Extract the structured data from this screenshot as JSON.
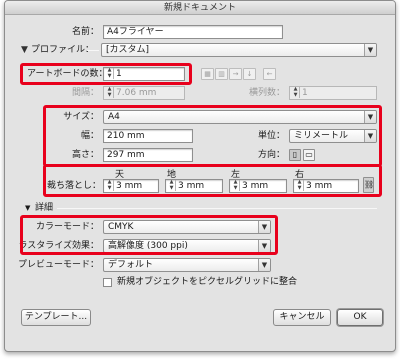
{
  "window": {
    "title": "新規ドキュメント"
  },
  "name": {
    "label": "名前：",
    "value": "A4フライヤー"
  },
  "profile": {
    "section_label": "プロファイル：",
    "value": "[カスタム]"
  },
  "artboards": {
    "count_label": "アートボードの数：",
    "count_value": "1",
    "spacing_label": "間隔：",
    "spacing_value": "7.06 mm",
    "columns_label": "横列数：",
    "columns_value": "1",
    "arrange_icons": [
      "grid-by-row-icon",
      "grid-by-column-icon",
      "arrange-by-row-icon",
      "arrange-by-column-icon",
      "change-to-right-to-left-icon"
    ]
  },
  "size": {
    "label": "サイズ：",
    "value": "A4"
  },
  "width": {
    "label": "幅：",
    "value": "210 mm"
  },
  "units": {
    "label": "単位：",
    "value": "ミリメートル"
  },
  "height": {
    "label": "高さ：",
    "value": "297 mm"
  },
  "orientation": {
    "label": "方向：",
    "icons": [
      "portrait-icon",
      "landscape-icon"
    ]
  },
  "bleed": {
    "label": "裁ち落とし：",
    "top_label": "天",
    "top_value": "3 mm",
    "bottom_label": "地",
    "bottom_value": "3 mm",
    "left_label": "左",
    "left_value": "3 mm",
    "right_label": "右",
    "right_value": "3 mm",
    "link_icon": "chain-link-icon"
  },
  "advanced": {
    "section_label": "詳細",
    "color_mode_label": "カラーモード：",
    "color_mode_value": "CMYK",
    "raster_label": "ラスタライズ効果：",
    "raster_value": "高解像度 (300 ppi)",
    "preview_label": "プレビューモード：",
    "preview_value": "デフォルト",
    "align_pixel_label": "新規オブジェクトをピクセルグリッドに整合"
  },
  "buttons": {
    "templates": "テンプレート...",
    "cancel": "キャンセル",
    "ok": "OK"
  },
  "colors": {
    "highlight": "#e8001c",
    "dialog_bg": "#e3e3e3"
  }
}
